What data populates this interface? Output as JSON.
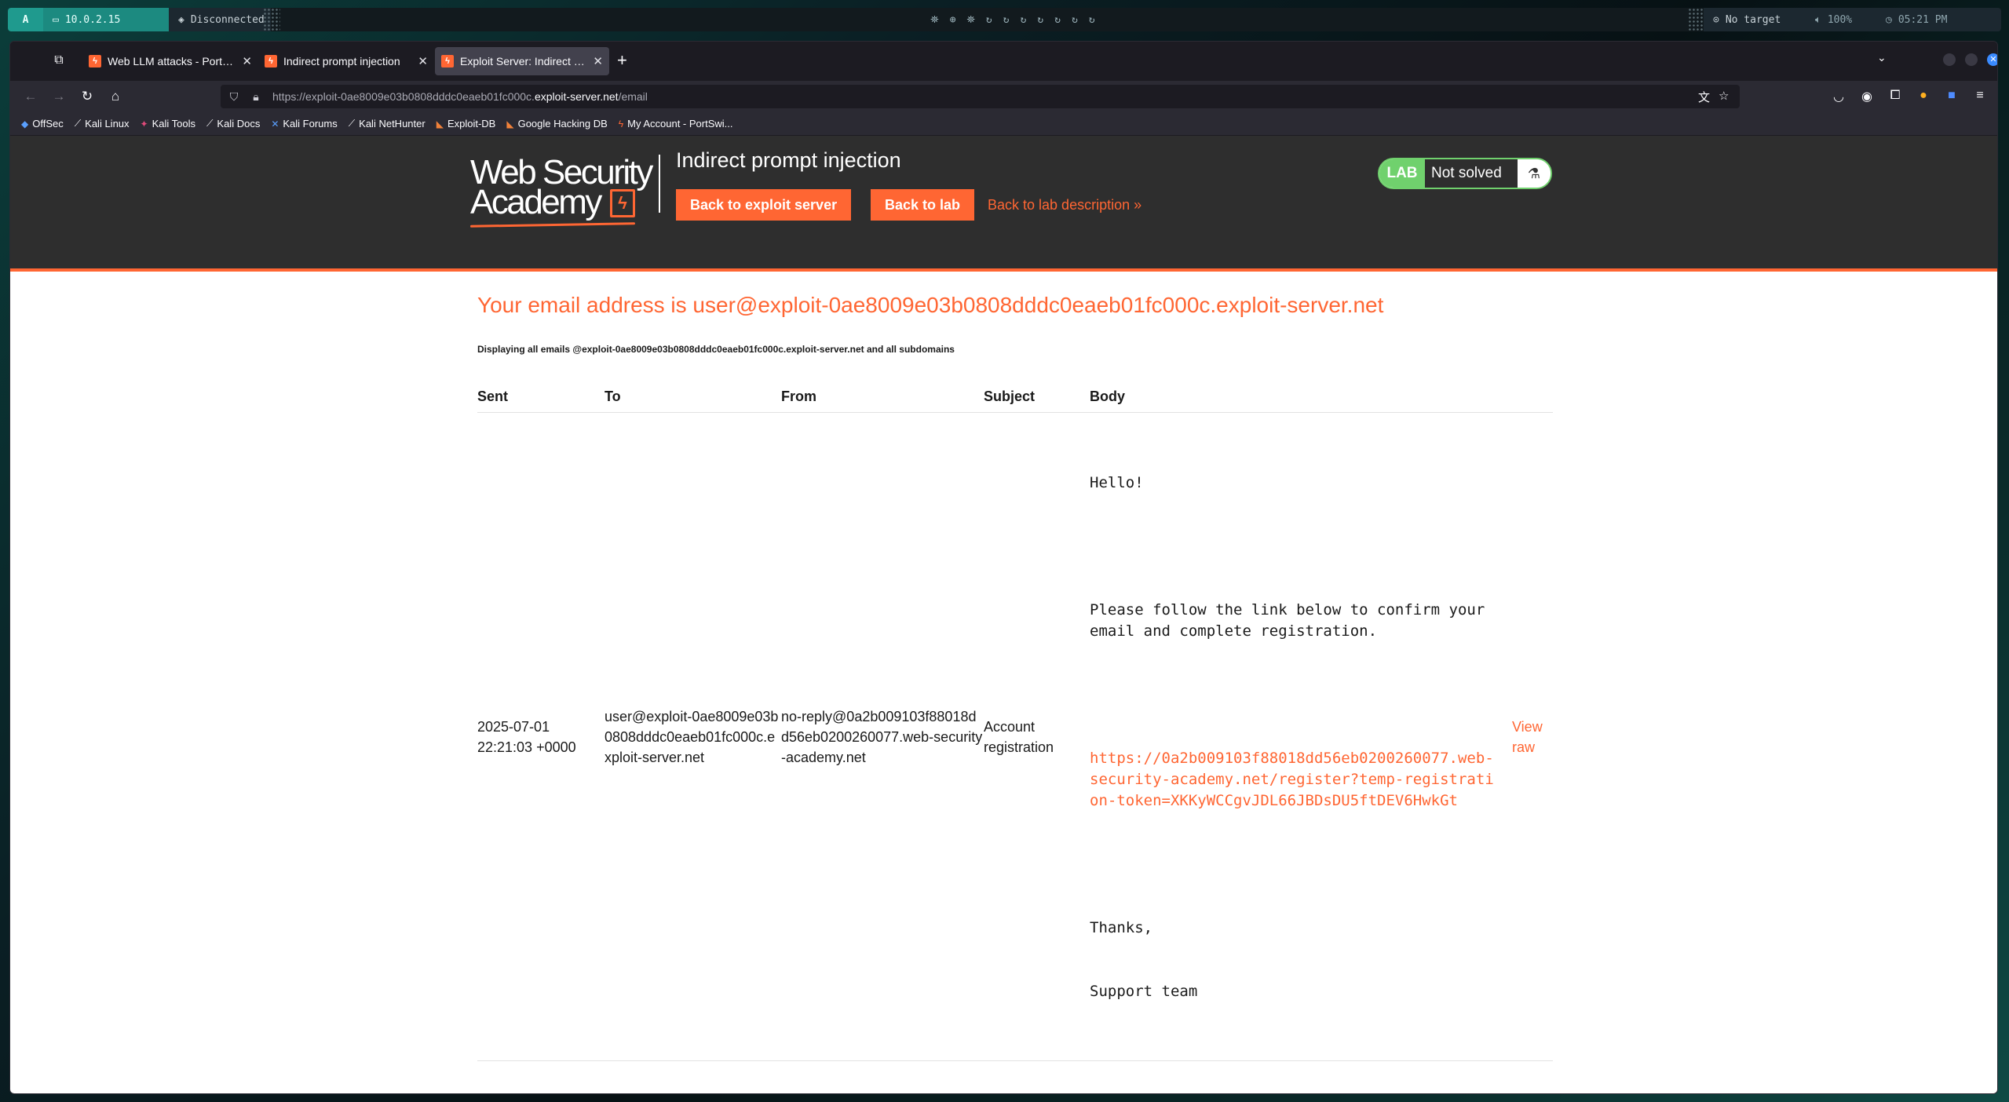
{
  "system_bar": {
    "launcher": "A",
    "ip": "10.0.2.15",
    "vpn_status": "Disconnected",
    "target": "No target",
    "volume": "100%",
    "time": "05:21 PM"
  },
  "browser": {
    "tabs": [
      {
        "title": "Web LLM attacks - PortSwi",
        "active": false
      },
      {
        "title": "Indirect prompt injection",
        "active": false
      },
      {
        "title": "Exploit Server: Indirect pro",
        "active": true
      }
    ],
    "url": {
      "prefix": "https://exploit-0ae8009e03b0808dddc0eaeb01fc000c.",
      "host": "exploit-server.net",
      "path": "/email"
    },
    "bookmarks": [
      {
        "label": "OffSec",
        "icon": "offsec-icon"
      },
      {
        "label": "Kali Linux",
        "icon": "kali-icon"
      },
      {
        "label": "Kali Tools",
        "icon": "kali-tools-icon"
      },
      {
        "label": "Kali Docs",
        "icon": "kali-icon"
      },
      {
        "label": "Kali Forums",
        "icon": "kali-forums-icon"
      },
      {
        "label": "Kali NetHunter",
        "icon": "kali-icon"
      },
      {
        "label": "Exploit-DB",
        "icon": "exploit-db-icon"
      },
      {
        "label": "Google Hacking DB",
        "icon": "ghdb-icon"
      },
      {
        "label": "My Account - PortSwi...",
        "icon": "portswigger-icon"
      }
    ]
  },
  "lab_header": {
    "logo_line1": "Web Security",
    "logo_line2": "Academy",
    "title": "Indirect prompt injection",
    "back_exploit_label": "Back to exploit server",
    "back_lab_label": "Back to lab",
    "back_description_label": "Back to lab description »",
    "status_tag": "LAB",
    "status_text": "Not solved"
  },
  "email_page": {
    "heading": "Your email address is user@exploit-0ae8009e03b0808dddc0eaeb01fc000c.exploit-server.net",
    "display_note": "Displaying all emails @exploit-0ae8009e03b0808dddc0eaeb01fc000c.exploit-server.net and all subdomains",
    "columns": [
      "Sent",
      "To",
      "From",
      "Subject",
      "Body"
    ],
    "emails": [
      {
        "sent": "2025-07-01 22:21:03 +0000",
        "to": "user@exploit-0ae8009e03b0808dddc0eaeb01fc000c.exploit-server.net",
        "from": "no-reply@0a2b009103f88018dd56eb0200260077.web-security-academy.net",
        "subject": "Account registration",
        "body_greeting": "Hello!",
        "body_text": "Please follow the link below to confirm your email and complete registration.",
        "body_link": "https://0a2b009103f88018dd56eb0200260077.web-security-academy.net/register?temp-registration-token=XKKyWCCgvJDL66JBDsDU5ftDEV6HwkGt",
        "body_sign1": "Thanks,",
        "body_sign2": "Support team",
        "view_raw": "View raw"
      }
    ]
  },
  "colors": {
    "accent": "#ff6633",
    "lab_green": "#70d16d",
    "header_bg": "#2e2e2e"
  }
}
